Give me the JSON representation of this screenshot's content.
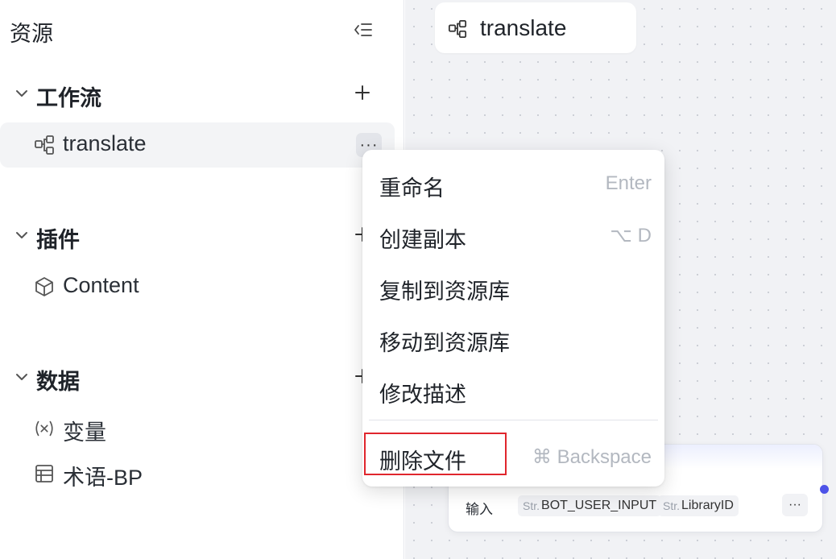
{
  "sidebar": {
    "title": "资源",
    "sections": {
      "workflow": {
        "label": "工作流",
        "items": [
          {
            "label": "translate"
          }
        ]
      },
      "plugin": {
        "label": "插件",
        "items": [
          {
            "label": "Content"
          }
        ]
      },
      "data": {
        "label": "数据",
        "items": [
          {
            "label": "变量"
          },
          {
            "label": "术语-BP"
          }
        ]
      }
    },
    "more_label": "···"
  },
  "canvas": {
    "tab_label": "translate",
    "node": {
      "input_label": "输入",
      "chip1_prefix": "Str.",
      "chip1_value": "BOT_USER_INPUT",
      "chip2_prefix": "Str.",
      "chip2_value": "LibraryID",
      "more_label": "···"
    }
  },
  "context_menu": {
    "items": [
      {
        "label": "重命名",
        "shortcut": "Enter"
      },
      {
        "label": "创建副本",
        "shortcut": "⌥ D"
      },
      {
        "label": "复制到资源库",
        "shortcut": ""
      },
      {
        "label": "移动到资源库",
        "shortcut": ""
      },
      {
        "label": "修改描述",
        "shortcut": ""
      },
      {
        "label": "删除文件",
        "shortcut": "⌘ Backspace"
      }
    ]
  },
  "colors": {
    "accent": "#4d53e8",
    "highlight": "#e0262d",
    "canvas_bg": "#f1f2f5"
  }
}
